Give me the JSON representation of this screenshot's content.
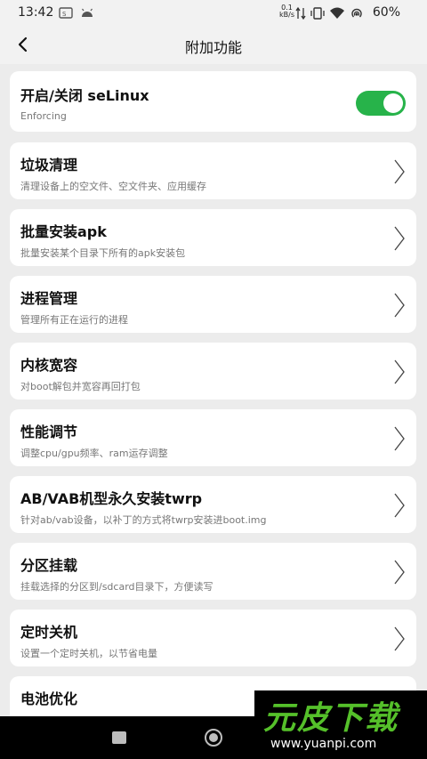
{
  "status_bar": {
    "time": "13:42",
    "net_speed_value": "0.1",
    "net_speed_unit": "kB/s",
    "battery": "60%"
  },
  "header": {
    "title": "附加功能",
    "back_icon": "chevron-left-icon"
  },
  "selinux": {
    "title": "开启/关闭 seLinux",
    "status": "Enforcing",
    "toggle_on": true,
    "toggle_color": "#27b34a"
  },
  "items": [
    {
      "title": "垃圾清理",
      "subtitle": "清理设备上的空文件、空文件夹、应用缓存"
    },
    {
      "title": "批量安装apk",
      "subtitle": "批量安装某个目录下所有的apk安装包"
    },
    {
      "title": "进程管理",
      "subtitle": "管理所有正在运行的进程"
    },
    {
      "title": "内核宽容",
      "subtitle": "对boot解包并宽容再回打包"
    },
    {
      "title": "性能调节",
      "subtitle": "调整cpu/gpu频率、ram运存调整"
    },
    {
      "title": "AB/VAB机型永久安装twrp",
      "subtitle": "针对ab/vab设备，以补丁的方式将twrp安装进boot.img"
    },
    {
      "title": "分区挂载",
      "subtitle": "挂载选择的分区到/sdcard目录下，方便读写"
    },
    {
      "title": "定时关机",
      "subtitle": "设置一个定时关机，以节省电量"
    },
    {
      "title": "电池优化",
      "subtitle": ""
    }
  ],
  "watermark": {
    "name": "元皮下载",
    "url": "www.yuanpi.com",
    "color": "#55c02a"
  }
}
